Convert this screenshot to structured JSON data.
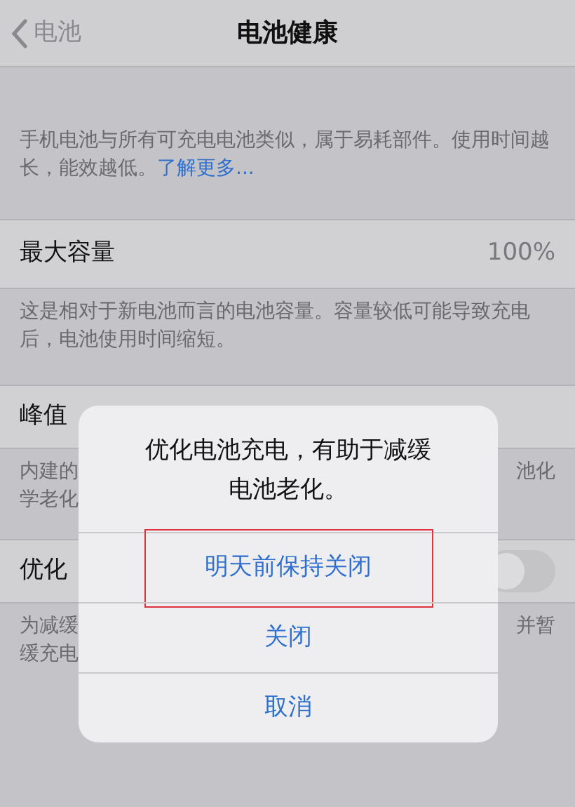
{
  "nav": {
    "back": "电池",
    "title": "电池健康"
  },
  "intro": {
    "text": "手机电池与所有可充电电池类似，属于易耗部件。使用时间越长，能效越低。",
    "link": "了解更多..."
  },
  "capacity": {
    "label": "最大容量",
    "value": "100%",
    "footer": "这是相对于新电池而言的电池容量。容量较低可能导致充电后，电池使用时间缩短。"
  },
  "peak": {
    "label": "峰值",
    "footer_left": [
      "内建的",
      "学老化"
    ],
    "footer_right": [
      "池化"
    ]
  },
  "optimize": {
    "label": "优化",
    "on": false,
    "footer_left": [
      "为减缓",
      "缓充电"
    ],
    "footer_right": [
      "并暂"
    ]
  },
  "dialog": {
    "message": "优化电池充电，有助于减缓电池老化。",
    "actions": [
      {
        "label": "明天前保持关闭",
        "highlighted": true
      },
      {
        "label": "关闭",
        "highlighted": false
      },
      {
        "label": "取消",
        "highlighted": false
      }
    ]
  }
}
